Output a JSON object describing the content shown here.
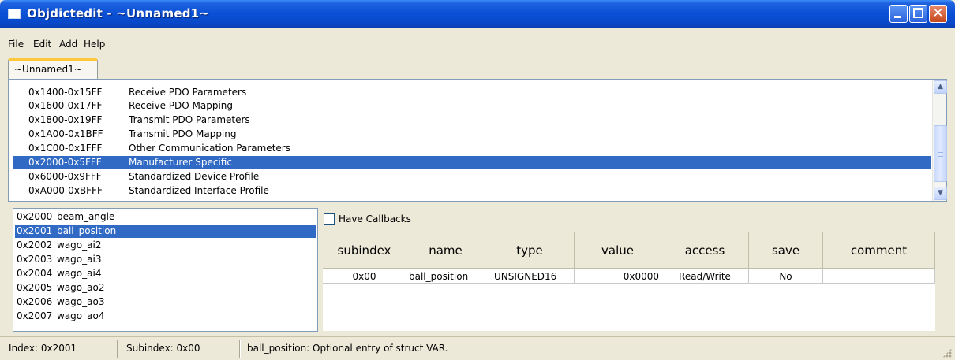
{
  "window": {
    "title": "Objdictedit - ~Unnamed1~",
    "controls": {
      "minimize": "minimize",
      "maximize": "maximize",
      "close": "✕"
    }
  },
  "menu": [
    "File",
    "Edit",
    "Add",
    "Help"
  ],
  "tab": {
    "label": "~Unnamed1~"
  },
  "ranges": [
    {
      "range": "0x1400-0x15FF",
      "name": "Receive PDO Parameters"
    },
    {
      "range": "0x1600-0x17FF",
      "name": "Receive PDO Mapping"
    },
    {
      "range": "0x1800-0x19FF",
      "name": "Transmit PDO Parameters"
    },
    {
      "range": "0x1A00-0x1BFF",
      "name": "Transmit PDO Mapping"
    },
    {
      "range": "0x1C00-0x1FFF",
      "name": "Other Communication Parameters"
    },
    {
      "range": "0x2000-0x5FFF",
      "name": "Manufacturer Specific"
    },
    {
      "range": "0x6000-0x9FFF",
      "name": "Standardized Device Profile"
    },
    {
      "range": "0xA000-0xBFFF",
      "name": "Standardized Interface Profile"
    }
  ],
  "selected_range_index": 5,
  "indexes": [
    {
      "index": "0x2000",
      "name": "beam_angle"
    },
    {
      "index": "0x2001",
      "name": "ball_position"
    },
    {
      "index": "0x2002",
      "name": "wago_ai2"
    },
    {
      "index": "0x2003",
      "name": "wago_ai3"
    },
    {
      "index": "0x2004",
      "name": "wago_ai4"
    },
    {
      "index": "0x2005",
      "name": "wago_ao2"
    },
    {
      "index": "0x2006",
      "name": "wago_ao3"
    },
    {
      "index": "0x2007",
      "name": "wago_ao4"
    }
  ],
  "selected_index": 1,
  "callbacks": {
    "label": "Have Callbacks",
    "checked": false
  },
  "grid": {
    "columns": [
      "subindex",
      "name",
      "type",
      "value",
      "access",
      "save",
      "comment"
    ],
    "rows": [
      {
        "subindex": "0x00",
        "name": "ball_position",
        "type": "UNSIGNED16",
        "value": "0x0000",
        "access": "Read/Write",
        "save": "No",
        "comment": ""
      }
    ]
  },
  "status": {
    "index": "Index: 0x2001",
    "subindex": "Subindex: 0x00",
    "message": "ball_position: Optional entry of struct VAR."
  }
}
